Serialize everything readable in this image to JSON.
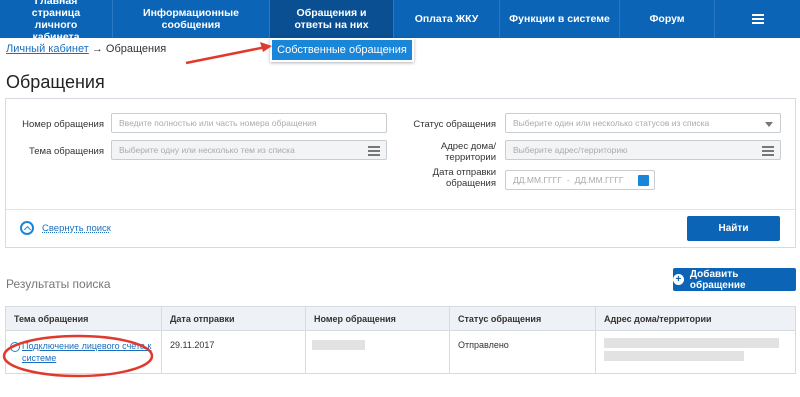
{
  "nav": {
    "items": [
      {
        "label": "Главная страница личного кабинета"
      },
      {
        "label": "Информационные сообщения"
      },
      {
        "label": "Обращения и ответы на них"
      },
      {
        "label": "Оплата ЖКУ"
      },
      {
        "label": "Функции в системе"
      },
      {
        "label": "Форум"
      }
    ],
    "menu_icon": "hamburger-icon"
  },
  "dropdown": {
    "item": "Собственные обращения"
  },
  "breadcrumb": {
    "home": "Личный кабинет",
    "separator": "→",
    "current": "Обращения"
  },
  "page_title": "Обращения",
  "search": {
    "number_label": "Номер обращения",
    "number_placeholder": "Введите полностью или часть номера обращения",
    "topic_label": "Тема обращения",
    "topic_placeholder": "Выберите одну или несколько тем из списка",
    "status_label": "Статус обращения",
    "status_placeholder": "Выберите один или несколько статусов из списка",
    "address_label": "Адрес дома/ территории",
    "address_placeholder": "Выберите адрес/территорию",
    "date_label": "Дата отправки обращения",
    "date_from": "ДД.ММ.ГГГГ",
    "date_sep": "-",
    "date_to": "ДД.ММ.ГГГГ",
    "collapse_label": "Свернуть поиск",
    "find_label": "Найти"
  },
  "results": {
    "title": "Результаты поиска",
    "add_label": "Добавить обращение",
    "columns": [
      "Тема обращения",
      "Дата отправки",
      "Номер обращения",
      "Статус обращения",
      "Адрес дома/территории"
    ],
    "rows": [
      {
        "topic": "Подключение лицевого счета к системе",
        "date": "29.11.2017",
        "status": "Отправлено"
      }
    ]
  },
  "colors": {
    "nav_bg": "#0b64b5",
    "accent": "#1a86d9",
    "annotation": "#e03a2e"
  }
}
